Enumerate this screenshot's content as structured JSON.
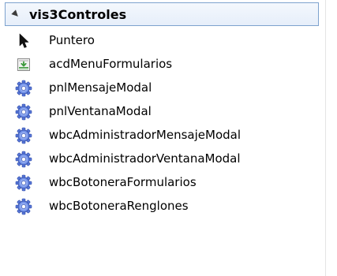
{
  "toolbox": {
    "group": {
      "title": "vis3Controles",
      "expanded": true,
      "expander_icon": "expanded-triangle-icon"
    },
    "items": [
      {
        "label": "Puntero",
        "icon": "pointer-arrow-icon"
      },
      {
        "label": "acdMenuFormularios",
        "icon": "menu-form-icon"
      },
      {
        "label": "pnlMensajeModal",
        "icon": "gear-icon"
      },
      {
        "label": "pnlVentanaModal",
        "icon": "gear-icon"
      },
      {
        "label": "wbcAdministradorMensajeModal",
        "icon": "gear-icon"
      },
      {
        "label": "wbcAdministradorVentanaModal",
        "icon": "gear-icon"
      },
      {
        "label": "wbcBotoneraFormularios",
        "icon": "gear-icon"
      },
      {
        "label": "wbcBotoneraRenglones",
        "icon": "gear-icon"
      }
    ]
  },
  "colors": {
    "header_border": "#7da2ce",
    "header_background": "#eaf1fb",
    "gear_blue": "#4d6fd6",
    "menu_icon_green": "#3c9a3c"
  }
}
